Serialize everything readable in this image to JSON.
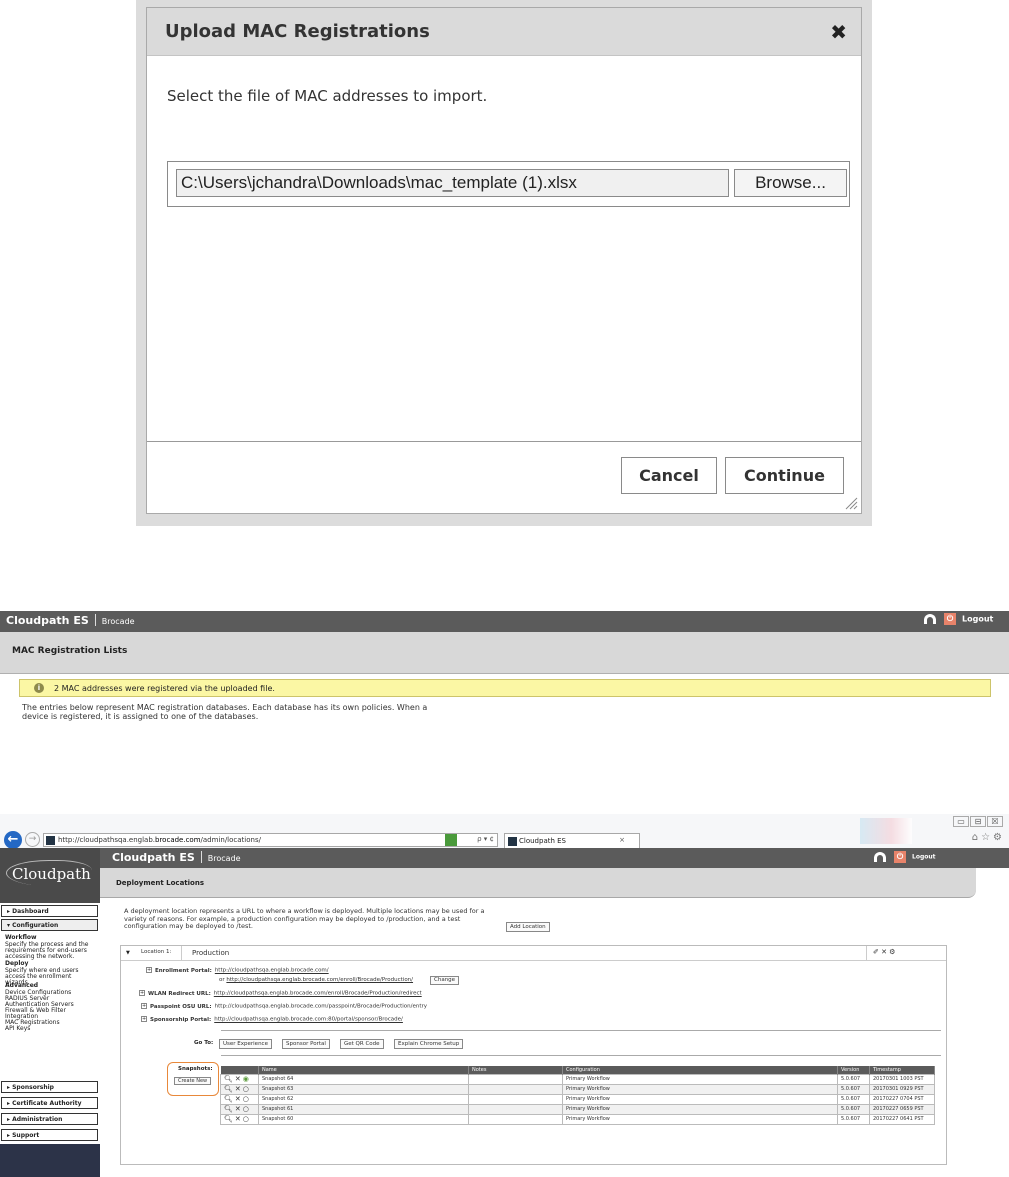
{
  "dialog": {
    "title": "Upload MAC Registrations",
    "close_glyph": "✖",
    "prompt": "Select the file of MAC addresses to import.",
    "file_path": "C:\\Users\\jchandra\\Downloads\\mac_template (1).xlsx",
    "browse_label": "Browse...",
    "cancel_label": "Cancel",
    "continue_label": "Continue"
  },
  "mac_page": {
    "brand": "Cloudpath ES",
    "org": "Brocade",
    "logout": "Logout",
    "power_glyph": "⏻",
    "header": "MAC Registration Lists",
    "notice": "2 MAC addresses were registered via the uploaded file.",
    "notice_icon": "i",
    "description": "The entries below represent MAC registration databases. Each database has its own policies. When a device is registered, it is assigned to one of the databases."
  },
  "browser": {
    "url_prefix": "http://cloudpathsqa.englab.",
    "url_host": "brocade.com",
    "url_suffix": "/admin/locations/",
    "addr_controls": "ρ ▾ ¢",
    "tab_title": "Cloudpath ES",
    "tab_close": "×",
    "back_glyph": "←",
    "fwd_glyph": "→",
    "win_min": "▭",
    "win_max": "⊟",
    "win_close": "☒",
    "tools": "⌂☆⚙"
  },
  "sidebar": {
    "logo": "Cloudpath",
    "dashboard": "Dashboard",
    "configuration": "Configuration",
    "workflow_title": "Workflow",
    "workflow_desc": "Specify the process and the requirements for end-users accessing the network.",
    "deploy_title": "Deploy",
    "deploy_desc": "Specify where end users access the enrollment wizards.",
    "advanced_title": "Advanced",
    "advanced_items": [
      "Device Configurations",
      "RADIUS Server",
      "Authentication Servers",
      "Firewall & Web Filter Integration",
      "MAC Registrations",
      "API Keys"
    ],
    "sponsorship": "Sponsorship",
    "certificate_authority": "Certificate Authority",
    "administration": "Administration",
    "support": "Support"
  },
  "deploy_page": {
    "brand": "Cloudpath ES",
    "org": "Brocade",
    "logout": "Logout",
    "power_glyph": "⏻",
    "header": "Deployment Locations",
    "description": "A deployment location represents a URL to where a workflow is deployed. Multiple locations may be used for a variety of reasons. For example, a production configuration may be deployed to /production, and a test configuration may be deployed to /test.",
    "add_location": "Add Location",
    "location_label": "Location 1:",
    "location_name": "Production",
    "actions": "✐ ✕ ⚙",
    "enrollment_label": "Enrollment Portal:",
    "enrollment_url": "http://cloudpathsqa.englab.brocade.com/",
    "enrollment_or": "or",
    "enrollment_url2": "http://cloudpathsqa.englab.brocade.com/enroll/Brocade/Production/",
    "change": "Change",
    "wlan_label": "WLAN Redirect URL:",
    "wlan_url": "http://cloudpathsqa.englab.brocade.com/enroll/Brocade/Production/redirect",
    "passpoint_label": "Passpoint OSU URL:",
    "passpoint_url": "http://cloudpathsqa.englab.brocade.com/passpoint/Brocade/Production/entry",
    "sponsorship_label": "Sponsorship Portal:",
    "sponsorship_url": "http://cloudpathsqa.englab.brocade.com:80/portal/sponsor/Brocade/",
    "goto_label": "Go To:",
    "goto_buttons": [
      "User Experience",
      "Sponsor Portal",
      "Get QR Code",
      "Explain Chrome Setup"
    ],
    "snapshots_label": "Snapshots:",
    "create_new": "Create New",
    "table_headers": [
      "",
      "Name",
      "Notes",
      "Configuration",
      "Version",
      "Timestamp"
    ],
    "snapshots": [
      {
        "name": "Snapshot 64",
        "notes": "",
        "config": "Primary Workflow",
        "version": "5.0.607",
        "timestamp": "20170301 1003 PST",
        "active": true
      },
      {
        "name": "Snapshot 63",
        "notes": "",
        "config": "Primary Workflow",
        "version": "5.0.607",
        "timestamp": "20170301 0929 PST",
        "active": false
      },
      {
        "name": "Snapshot 62",
        "notes": "",
        "config": "Primary Workflow",
        "version": "5.0.607",
        "timestamp": "20170227 0704 PST",
        "active": false
      },
      {
        "name": "Snapshot 61",
        "notes": "",
        "config": "Primary Workflow",
        "version": "5.0.607",
        "timestamp": "20170227 0659 PST",
        "active": false
      },
      {
        "name": "Snapshot 60",
        "notes": "",
        "config": "Primary Workflow",
        "version": "5.0.607",
        "timestamp": "20170227 0641 PST",
        "active": false
      }
    ]
  }
}
